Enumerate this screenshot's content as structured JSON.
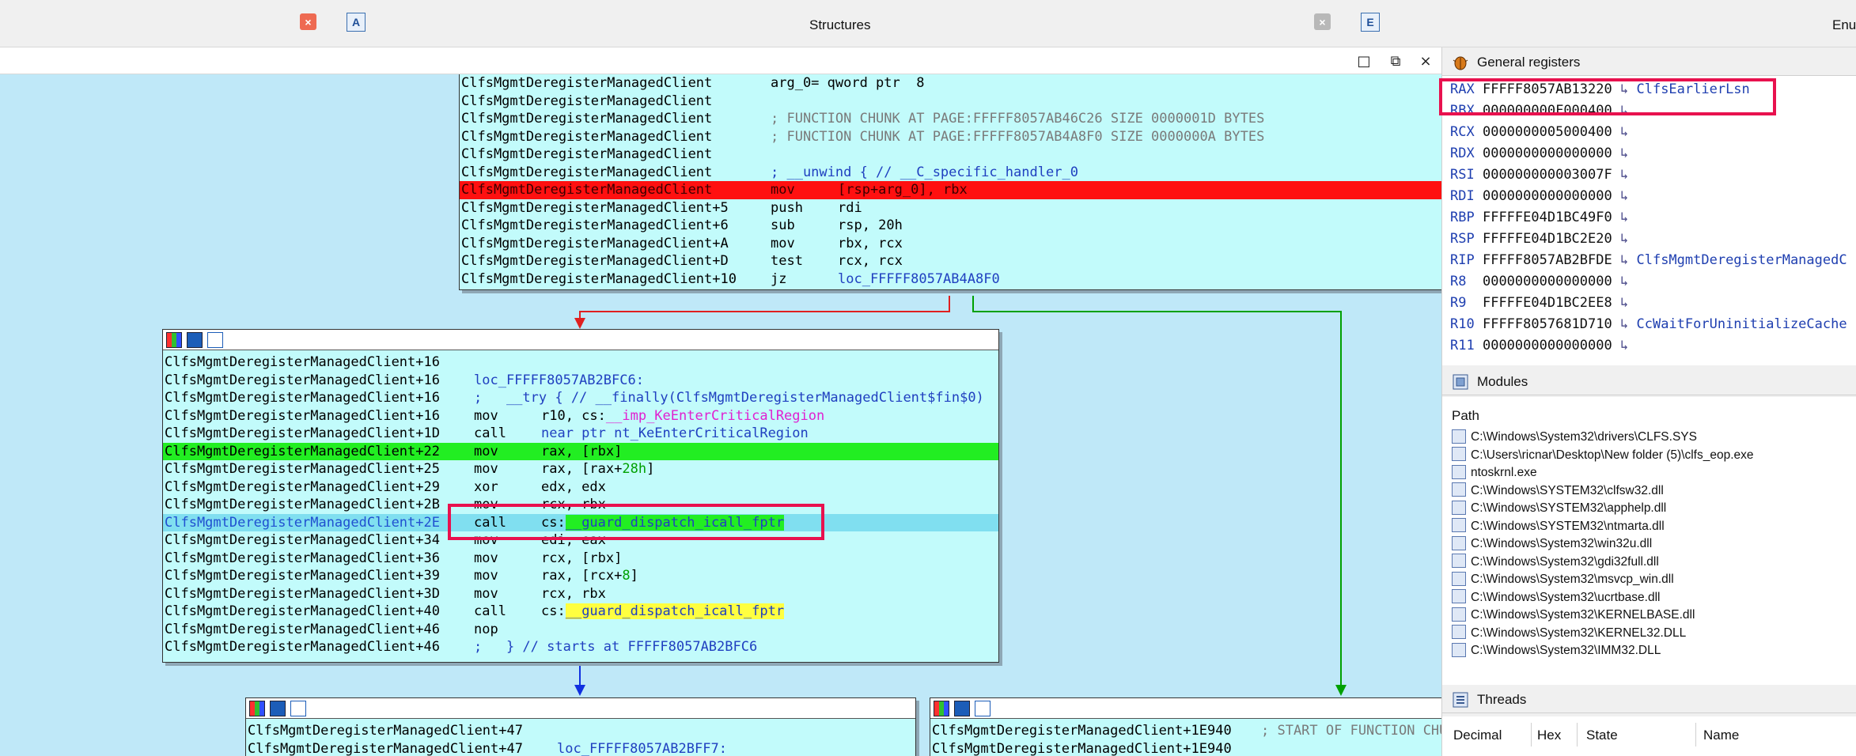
{
  "top_tabs": {
    "left_tab_close": "×",
    "structures_icon": "A",
    "structures_title": "Structures",
    "structures_close": "×",
    "enums_icon": "E",
    "enums_title_partial": "Enu"
  },
  "window_buttons": {
    "maximize": "□",
    "restore": "⧉",
    "close": "×"
  },
  "icons": {
    "tab_close": "close-icon",
    "structures": "structures-icon",
    "enums": "enums-icon",
    "block_header": [
      "graph-color-icon",
      "edit-block-icon",
      "xref-graph-icon"
    ],
    "registers_panel": "bug-icon",
    "modules_panel": "modules-icon",
    "threads_panel": "threads-icon",
    "module_item": "dll-icon",
    "register_pointer": "pointer-arrow-icon"
  },
  "colors": {
    "graph_background": "#bfe8f8",
    "block_background": "#c2fbfb",
    "current_instruction": "#ff1010",
    "breakpoint_line": "#22ee22",
    "selected_line": "#80dff0",
    "highlight_box": "#e8114e",
    "edge_true": "#00a000",
    "edge_false": "#e02020",
    "edge_flow": "#1030e0"
  },
  "block1": {
    "rows": [
      {
        "label": "ClfsMgmtDeregisterManagedClient",
        "mnem": "arg_0= qword ptr  8",
        "op": ""
      },
      {
        "label": "ClfsMgmtDeregisterManagedClient",
        "mnem": "",
        "op": ""
      },
      {
        "label": "ClfsMgmtDeregisterManagedClient",
        "mnem": "; FUNCTION CHUNK AT PAGE:FFFFF8057AB46C26 SIZE 0000001D BYTES",
        "op": ""
      },
      {
        "label": "ClfsMgmtDeregisterManagedClient",
        "mnem": "; FUNCTION CHUNK AT PAGE:FFFFF8057AB4A8F0 SIZE 0000000A BYTES",
        "op": ""
      },
      {
        "label": "ClfsMgmtDeregisterManagedClient",
        "mnem": "",
        "op": ""
      },
      {
        "label": "ClfsMgmtDeregisterManagedClient",
        "mnem": "; __unwind { // __C_specific_handler_0",
        "op": ""
      },
      {
        "label": "ClfsMgmtDeregisterManagedClient",
        "mnem": "mov",
        "op": "[rsp+arg_0], rbx"
      },
      {
        "label": "ClfsMgmtDeregisterManagedClient+5",
        "mnem": "push",
        "op": "rdi"
      },
      {
        "label": "ClfsMgmtDeregisterManagedClient+6",
        "mnem": "sub",
        "op": "rsp, 20h"
      },
      {
        "label": "ClfsMgmtDeregisterManagedClient+A",
        "mnem": "mov",
        "op": "rbx, rcx"
      },
      {
        "label": "ClfsMgmtDeregisterManagedClient+D",
        "mnem": "test",
        "op": "rcx, rcx"
      },
      {
        "label": "ClfsMgmtDeregisterManagedClient+10",
        "mnem": "jz",
        "op": "loc_FFFFF8057AB4A8F0"
      }
    ]
  },
  "block2": {
    "rows": [
      {
        "label": "ClfsMgmtDeregisterManagedClient+16",
        "mnem": "",
        "op": ""
      },
      {
        "label": "ClfsMgmtDeregisterManagedClient+16",
        "mnem": "loc_FFFFF8057AB2BFC6:",
        "op": ""
      },
      {
        "label": "ClfsMgmtDeregisterManagedClient+16",
        "mnem": ";   __try { // __finally(ClfsMgmtDeregisterManagedClient$fin$0)",
        "op": ""
      },
      {
        "label": "ClfsMgmtDeregisterManagedClient+16",
        "mnem": "mov",
        "op": "r10, cs:",
        "op2": "__imp_KeEnterCriticalRegion"
      },
      {
        "label": "ClfsMgmtDeregisterManagedClient+1D",
        "mnem": "call",
        "op": "near ptr nt_KeEnterCriticalRegion"
      },
      {
        "label": "ClfsMgmtDeregisterManagedClient+22",
        "mnem": "mov",
        "op": "rax, [rbx]"
      },
      {
        "label": "ClfsMgmtDeregisterManagedClient+25",
        "mnem": "mov",
        "op": "rax, [rax+",
        "op2": "28h",
        "op3": "]"
      },
      {
        "label": "ClfsMgmtDeregisterManagedClient+29",
        "mnem": "xor",
        "op": "edx, edx"
      },
      {
        "label": "ClfsMgmtDeregisterManagedClient+2B",
        "mnem": "mov",
        "op": "rcx, rbx"
      },
      {
        "label": "ClfsMgmtDeregisterManagedClient+2E",
        "mnem": "call",
        "op": "cs:",
        "op2": "__guard_dispatch_icall_fptr"
      },
      {
        "label": "ClfsMgmtDeregisterManagedClient+34",
        "mnem": "mov",
        "op": "edi, eax"
      },
      {
        "label": "ClfsMgmtDeregisterManagedClient+36",
        "mnem": "mov",
        "op": "rcx, [rbx]"
      },
      {
        "label": "ClfsMgmtDeregisterManagedClient+39",
        "mnem": "mov",
        "op": "rax, [rcx+",
        "op2": "8",
        "op3": "]"
      },
      {
        "label": "ClfsMgmtDeregisterManagedClient+3D",
        "mnem": "mov",
        "op": "rcx, rbx"
      },
      {
        "label": "ClfsMgmtDeregisterManagedClient+40",
        "mnem": "call",
        "op": "cs:",
        "op2": "__guard_dispatch_icall_fptr"
      },
      {
        "label": "ClfsMgmtDeregisterManagedClient+46",
        "mnem": "nop",
        "op": ""
      },
      {
        "label": "ClfsMgmtDeregisterManagedClient+46",
        "mnem": ";   } // starts at FFFFF8057AB2BFC6",
        "op": ""
      }
    ]
  },
  "block3": {
    "rows": [
      {
        "label": "ClfsMgmtDeregisterManagedClient+47",
        "mnem": "",
        "op": ""
      },
      {
        "label": "ClfsMgmtDeregisterManagedClient+47",
        "mnem": "loc_FFFFF8057AB2BFF7:",
        "op": ""
      }
    ]
  },
  "block4": {
    "rows": [
      {
        "label": "ClfsMgmtDeregisterManagedClient+1E940",
        "mnem": "; START OF FUNCTION CHUN",
        "op": ""
      },
      {
        "label": "ClfsMgmtDeregisterManagedClient+1E940",
        "mnem": "",
        "op": ""
      }
    ]
  },
  "registers": {
    "title": "General registers",
    "items": [
      {
        "name": "RAX",
        "value": "FFFFF8057AB13220",
        "arrow": "↳",
        "symbol": "ClfsEarlierLsn"
      },
      {
        "name": "RBX",
        "value": "000000000F000400",
        "arrow": "↳",
        "symbol": ""
      },
      {
        "name": "RCX",
        "value": "0000000005000400",
        "arrow": "↳",
        "symbol": ""
      },
      {
        "name": "RDX",
        "value": "0000000000000000",
        "arrow": "↳",
        "symbol": ""
      },
      {
        "name": "RSI",
        "value": "000000000003007F",
        "arrow": "↳",
        "symbol": ""
      },
      {
        "name": "RDI",
        "value": "0000000000000000",
        "arrow": "↳",
        "symbol": ""
      },
      {
        "name": "RBP",
        "value": "FFFFFE04D1BC49F0",
        "arrow": "↳",
        "symbol": ""
      },
      {
        "name": "RSP",
        "value": "FFFFFE04D1BC2E20",
        "arrow": "↳",
        "symbol": ""
      },
      {
        "name": "RIP",
        "value": "FFFFF8057AB2BFDE",
        "arrow": "↳",
        "symbol": "ClfsMgmtDeregisterManagedC"
      },
      {
        "name": "R8 ",
        "value": "0000000000000000",
        "arrow": "↳",
        "symbol": ""
      },
      {
        "name": "R9 ",
        "value": "FFFFFE04D1BC2EE8",
        "arrow": "↳",
        "symbol": ""
      },
      {
        "name": "R10",
        "value": "FFFFF8057681D710",
        "arrow": "↳",
        "symbol": "CcWaitForUninitializeCache"
      },
      {
        "name": "R11",
        "value": "0000000000000000",
        "arrow": "↳",
        "symbol": ""
      }
    ]
  },
  "modules": {
    "title": "Modules",
    "column": "Path",
    "items": [
      "C:\\Windows\\System32\\drivers\\CLFS.SYS",
      "C:\\Users\\ricnar\\Desktop\\New folder (5)\\clfs_eop.exe",
      "ntoskrnl.exe",
      "C:\\Windows\\SYSTEM32\\clfsw32.dll",
      "C:\\Windows\\SYSTEM32\\apphelp.dll",
      "C:\\Windows\\SYSTEM32\\ntmarta.dll",
      "C:\\Windows\\System32\\win32u.dll",
      "C:\\Windows\\System32\\gdi32full.dll",
      "C:\\Windows\\System32\\msvcp_win.dll",
      "C:\\Windows\\System32\\ucrtbase.dll",
      "C:\\Windows\\System32\\KERNELBASE.dll",
      "C:\\Windows\\System32\\KERNEL32.DLL",
      "C:\\Windows\\System32\\IMM32.DLL"
    ]
  },
  "threads": {
    "title": "Threads",
    "columns": [
      "Decimal",
      "Hex",
      "State",
      "Name"
    ]
  }
}
